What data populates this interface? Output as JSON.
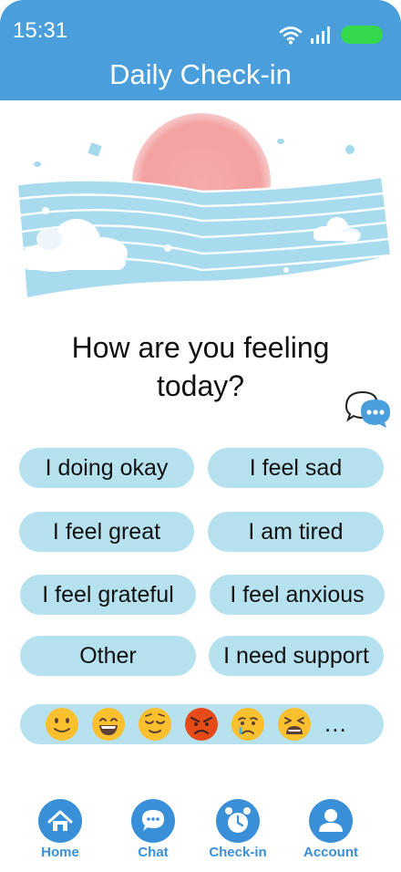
{
  "status_bar": {
    "time": "15:31"
  },
  "header": {
    "title": "Daily Check-in"
  },
  "prompt": {
    "question": "How are you feeling today?"
  },
  "options": [
    {
      "label": "I doing okay"
    },
    {
      "label": "I feel sad"
    },
    {
      "label": "I feel great"
    },
    {
      "label": "I am tired"
    },
    {
      "label": "I feel grateful"
    },
    {
      "label": "I feel anxious"
    },
    {
      "label": "Other"
    },
    {
      "label": "I need support"
    }
  ],
  "emoji_bar": {
    "emojis": [
      "slightly-smiling",
      "grinning",
      "relieved",
      "angry",
      "crying",
      "weary"
    ],
    "more": "..."
  },
  "nav": [
    {
      "label": "Home",
      "icon": "home-icon"
    },
    {
      "label": "Chat",
      "icon": "chat-icon"
    },
    {
      "label": "Check-in",
      "icon": "alarm-clock-icon"
    },
    {
      "label": "Account",
      "icon": "user-icon"
    }
  ],
  "colors": {
    "header": "#4a9edb",
    "pill": "#b6e1ef",
    "nav_accent": "#3a8fd9",
    "battery": "#33d94a",
    "sun": "#f4a3a3"
  }
}
